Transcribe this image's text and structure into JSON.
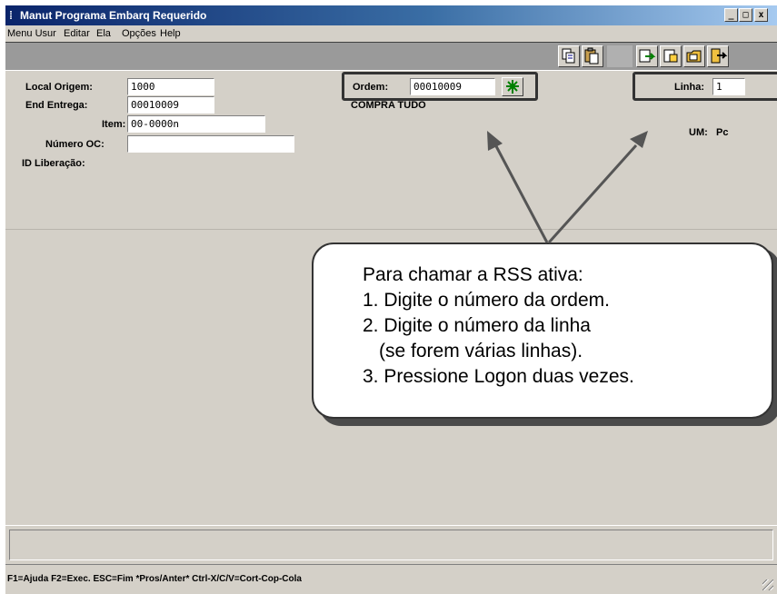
{
  "window": {
    "title": "Manut Programa Embarq Requerido",
    "title_icon": "app-icon",
    "controls": {
      "minimize": "_",
      "maximize": "□",
      "close": "x"
    }
  },
  "menu": {
    "items": [
      "Menu Usur",
      "Editar",
      "Ela",
      "Opções",
      "Help"
    ]
  },
  "toolbar": {
    "buttons": [
      "copy-icon",
      "paste-icon",
      "logon-icon",
      "export-icon",
      "folder-icon",
      "exit-icon"
    ]
  },
  "form": {
    "local_origem_label": "Local Origem:",
    "local_origem_value": "1000",
    "end_entrega_label": "End Entrega:",
    "end_entrega_value": "00010009",
    "item_label": "Item:",
    "item_value": "00-0000n",
    "numero_oc_label": "Número OC:",
    "numero_oc_value": "",
    "id_liberacao_label": "ID Liberação:",
    "ordem_label": "Ordem:",
    "ordem_value": "00010009",
    "ordem_desc": "COMPRA TUDO",
    "linha_label": "Linha:",
    "linha_value": "1",
    "um_label": "UM:",
    "um_value": "Pc"
  },
  "callout": {
    "line1": "Para chamar a RSS ativa:",
    "line2": "1. Digite o número da ordem.",
    "line3": "2. Digite o número da linha",
    "line4": "(se forem várias linhas).",
    "line5": "3. Pressione Logon duas vezes."
  },
  "status": {
    "hints": "F1=Ajuda F2=Exec. ESC=Fim *Pros/Anter* Ctrl-X/C/V=Cort-Cop-Cola"
  },
  "colors": {
    "titlebar": "#0a246a",
    "window_bg": "#d4d0c8",
    "toolbar_bg": "#9a9a9a",
    "highlight_border": "#333333",
    "arrow": "#555555"
  }
}
